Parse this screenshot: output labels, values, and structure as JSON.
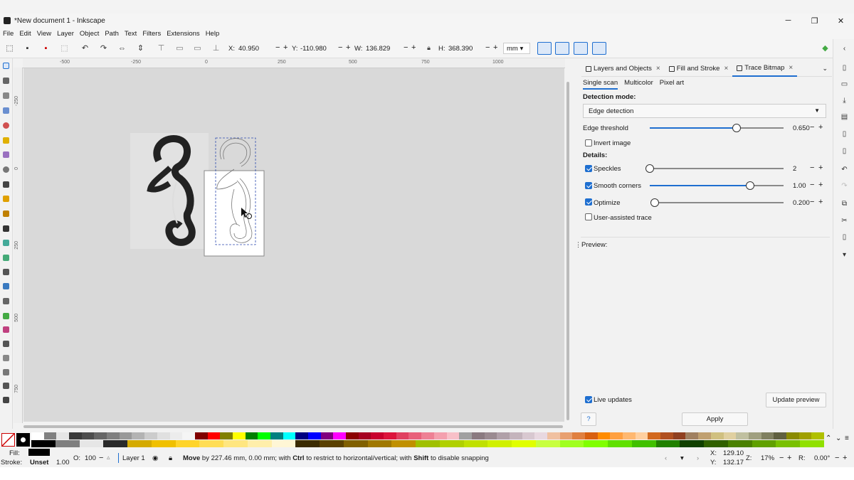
{
  "window": {
    "title": "*New document 1 - Inkscape",
    "minimize": "─",
    "maximize": "❐",
    "close": "✕"
  },
  "menu": [
    "File",
    "Edit",
    "View",
    "Layer",
    "Object",
    "Path",
    "Text",
    "Filters",
    "Extensions",
    "Help"
  ],
  "toolbar": {
    "x_label": "X:",
    "x_value": "40.950",
    "y_label": "Y:",
    "y_value": "-110.980",
    "w_label": "W:",
    "w_value": "136.829",
    "h_label": "H:",
    "h_value": "368.390",
    "unit": "mm",
    "minus": "−",
    "plus": "+"
  },
  "ruler": {
    "h_ticks": [
      "-500",
      "-250",
      "0",
      "250",
      "500",
      "750",
      "1000"
    ],
    "v_ticks": [
      "-250",
      "0",
      "250",
      "500",
      "750"
    ]
  },
  "tabs": [
    {
      "label": "Layers and Objects"
    },
    {
      "label": "Fill and Stroke"
    },
    {
      "label": "Trace Bitmap"
    }
  ],
  "tab_close": "×",
  "trace": {
    "subtabs": [
      "Single scan",
      "Multicolor",
      "Pixel art"
    ],
    "detection_mode_label": "Detection mode:",
    "detection_mode_value": "Edge detection",
    "edge_threshold_label": "Edge threshold",
    "edge_threshold_value": "0.650",
    "edge_threshold_fraction": 0.65,
    "invert_label": "Invert image",
    "details_label": "Details:",
    "speckles_label": "Speckles",
    "speckles_value": "2",
    "speckles_fraction": 0.0,
    "smooth_label": "Smooth corners",
    "smooth_value": "1.00",
    "smooth_fraction": 0.75,
    "optimize_label": "Optimize",
    "optimize_value": "0.200",
    "optimize_fraction": 0.0,
    "user_assisted_label": "User-assisted trace",
    "preview_label": "Preview:",
    "live_updates_label": "Live updates",
    "update_preview_label": "Update preview",
    "apply_label": "Apply"
  },
  "status": {
    "fill_label": "Fill:",
    "stroke_label": "Stroke:",
    "stroke_value": "Unset",
    "stroke_width": "1.00",
    "opacity_label": "O:",
    "opacity_value": "100",
    "layer_name": "Layer 1",
    "message_action": "Move",
    "message_text": " by 227.46 mm, 0.00 mm; with ",
    "message_ctrl": "Ctrl",
    "message_text2": " to restrict to horizontal/vertical; with ",
    "message_shift": "Shift",
    "message_text3": " to disable snapping",
    "cursor_x_label": "X:",
    "cursor_x": "129.10",
    "cursor_y_label": "Y:",
    "cursor_y": "132.17",
    "zoom_label": "Z:",
    "zoom_value": "17%",
    "rotate_label": "R:",
    "rotate_value": "0.00°"
  },
  "palette_colors": [
    "#ffffff",
    "#808080",
    "#e6e6e6",
    "#3a3a3a",
    "#4d4d4d",
    "#666666",
    "#7f7f7f",
    "#999999",
    "#b3b3b3",
    "#cccccc",
    "#e0e0e0",
    "#ececec",
    "#f5f5f5",
    "#800000",
    "#ff0000",
    "#808000",
    "#ffff00",
    "#008000",
    "#00ff00",
    "#008080",
    "#00ffff",
    "#000080",
    "#0000ff",
    "#800080",
    "#ff00ff",
    "#8b0000",
    "#a50021",
    "#c8002e",
    "#dc143c",
    "#e04060",
    "#e8607a",
    "#ee8094",
    "#f4a0ae",
    "#f8c0c8",
    "#a0a0a0",
    "#8a7a80",
    "#9a8a90",
    "#b0a0a8",
    "#c4b4bc",
    "#d8c8d0",
    "#e8d8e0",
    "#f0c0a0",
    "#e8a070",
    "#e08040",
    "#d86010",
    "#ff8c00",
    "#ffa040",
    "#ffb870",
    "#ffd0a0",
    "#d2691e",
    "#b05020",
    "#904020",
    "#a08060",
    "#c0a070",
    "#d0c080",
    "#e0d0a0",
    "#c0c0a0",
    "#a0a080",
    "#808060",
    "#606040",
    "#8a8a00",
    "#a0a000",
    "#b0c000"
  ],
  "palette_colors2": [
    "#000000",
    "#7f7f7f",
    "#e6e6e6",
    "#2a2a2a",
    "#d4aa00",
    "#f0c000",
    "#ffd42a",
    "#ffdd55",
    "#ffe680",
    "#ffeeaa",
    "#fff6d5",
    "#3a2a00",
    "#5a4000",
    "#806000",
    "#a07800",
    "#c09000",
    "#a0c000",
    "#b0d000",
    "#c0e000",
    "#d0f000",
    "#e0ff00",
    "#c8ff40",
    "#a0ff20",
    "#80ff00",
    "#60e000",
    "#40c000",
    "#208000",
    "#104000",
    "#306000",
    "#4a8000",
    "#60a000",
    "#78c000",
    "#90e000"
  ]
}
